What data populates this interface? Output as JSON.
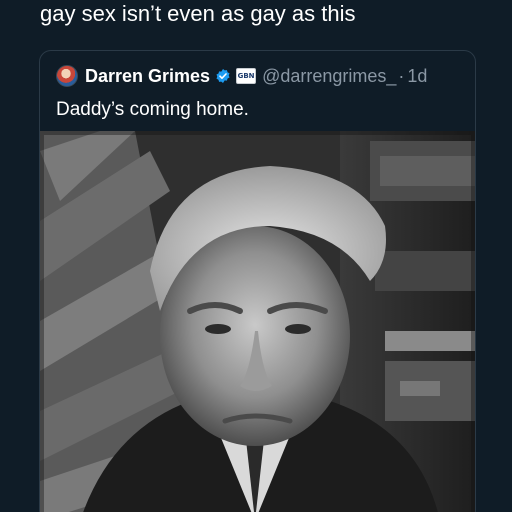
{
  "post": {
    "text": "gay sex isn’t even as gay as this"
  },
  "quoted_tweet": {
    "display_name": "Darren Grimes",
    "handle": "@darrengrimes_",
    "separator": "·",
    "time": "1d",
    "text": "Daddy’s coming home.",
    "affiliate_badge_text": "GBN",
    "icons": [
      "avatar",
      "verified-badge-icon",
      "affiliate-badge"
    ],
    "image_description_icon": "photo"
  },
  "colors": {
    "background": "#0f1c27",
    "card_border": "#2b3a47",
    "secondary_text": "#8b98a5",
    "verified_blue": "#1d9bf0"
  }
}
